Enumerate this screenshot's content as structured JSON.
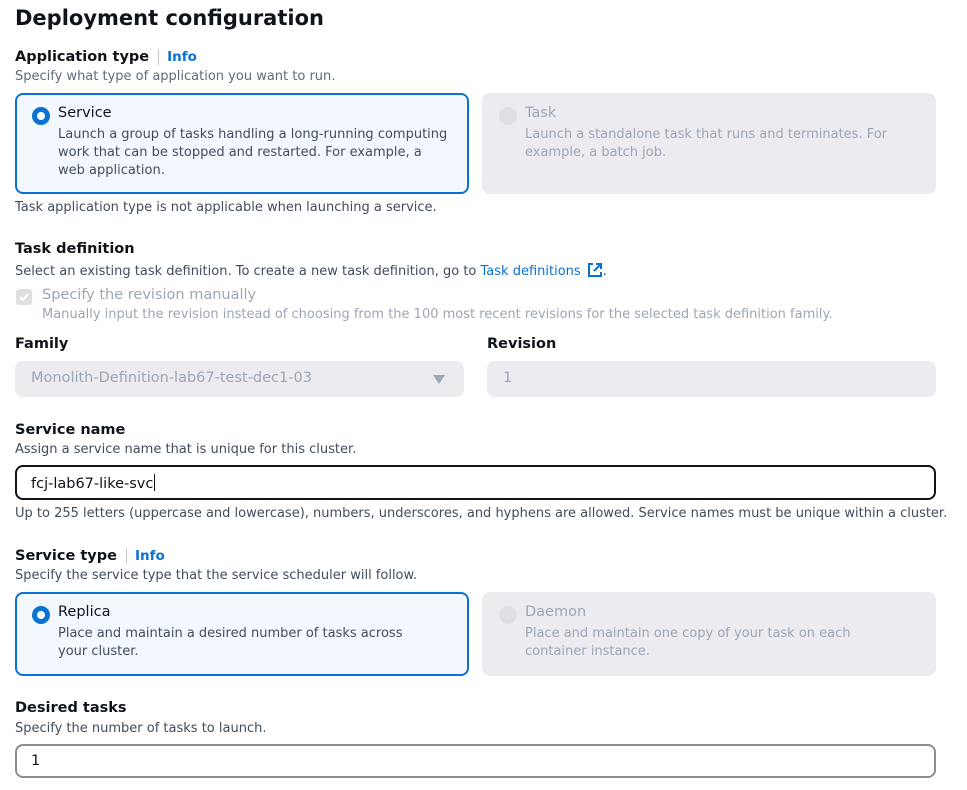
{
  "page": {
    "title": "Deployment configuration"
  },
  "application_type": {
    "label": "Application type",
    "info": "Info",
    "description": "Specify what type of application you want to run.",
    "options": [
      {
        "title": "Service",
        "description": "Launch a group of tasks handling a long-running computing work that can be stopped and restarted. For example, a web application.",
        "selected": true,
        "disabled": false
      },
      {
        "title": "Task",
        "description": "Launch a standalone task that runs and terminates. For example, a batch job.",
        "selected": false,
        "disabled": true
      }
    ],
    "note": "Task application type is not applicable when launching a service."
  },
  "task_definition": {
    "label": "Task definition",
    "description_prefix": "Select an existing task definition. To create a new task definition, go to ",
    "link_text": "Task definitions",
    "description_suffix": ".",
    "link_icon": "external-link-icon",
    "manual_revision": {
      "label": "Specify the revision manually",
      "description": "Manually input the revision instead of choosing from the 100 most recent revisions for the selected task definition family.",
      "checked": true,
      "disabled": true
    },
    "family": {
      "label": "Family",
      "value": "Monolith-Definition-lab67-test-dec1-03"
    },
    "revision": {
      "label": "Revision",
      "value": "1"
    }
  },
  "service_name": {
    "label": "Service name",
    "description": "Assign a service name that is unique for this cluster.",
    "value": "fcj-lab67-like-svc",
    "constraint": "Up to 255 letters (uppercase and lowercase), numbers, underscores, and hyphens are allowed. Service names must be unique within a cluster."
  },
  "service_type": {
    "label": "Service type",
    "info": "Info",
    "description": "Specify the service type that the service scheduler will follow.",
    "options": [
      {
        "title": "Replica",
        "description": "Place and maintain a desired number of tasks across your cluster.",
        "selected": true,
        "disabled": false
      },
      {
        "title": "Daemon",
        "description": "Place and maintain one copy of your task on each container instance.",
        "selected": false,
        "disabled": true
      }
    ]
  },
  "desired_tasks": {
    "label": "Desired tasks",
    "description": "Specify the number of tasks to launch.",
    "value": "1"
  },
  "colors": {
    "accent": "#0972d3",
    "text": "#0f141a",
    "muted": "#5f6b7a",
    "disabled_bg": "#ebebf0",
    "disabled_text": "#9ba7b6",
    "selected_bg": "#f2f8fd"
  }
}
